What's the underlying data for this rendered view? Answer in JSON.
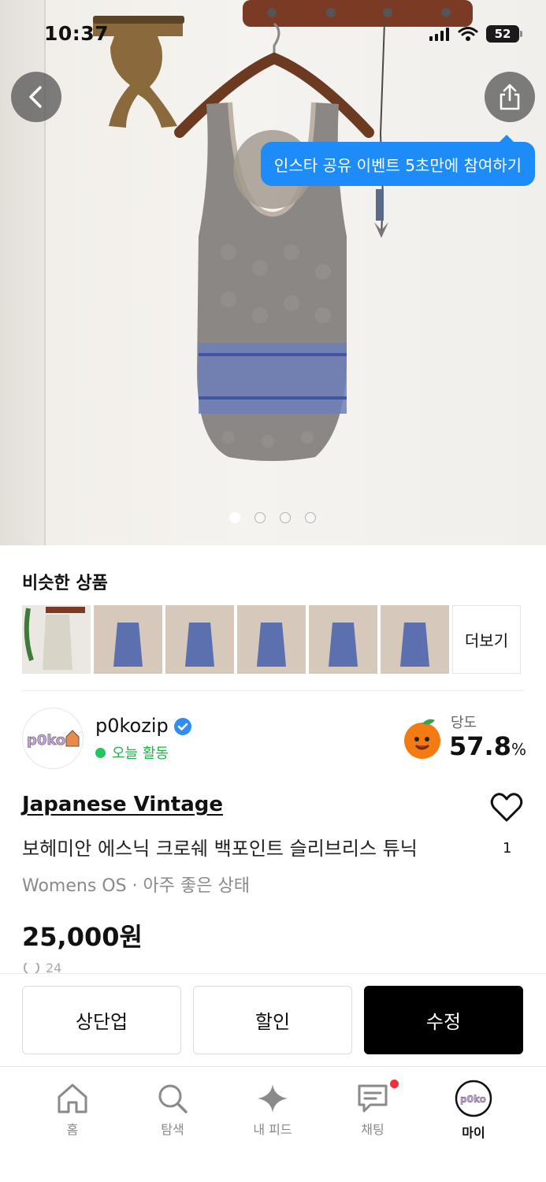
{
  "status_bar": {
    "time": "10:37",
    "battery": "52"
  },
  "hero": {
    "back_icon": "chevron-left-icon",
    "share_icon": "share-icon",
    "tooltip": "인스타 공유 이벤트 5초만에 참여하기",
    "page_count": 4,
    "active_page": 0
  },
  "similar": {
    "title": "비슷한 상품",
    "more_label": "더보기",
    "thumb_count": 6
  },
  "seller": {
    "name": "p0kozip",
    "activity": "오늘 활동",
    "dangdo_label": "당도",
    "dangdo_value": "57.8",
    "dangdo_unit": "%",
    "avatar_text": "p0ko"
  },
  "product": {
    "brand": "Japanese Vintage",
    "title": "보헤미안 에스닉 크로쉐 백포인트 슬리브리스 튜닉",
    "meta": "Womens OS · 아주 좋은 상태",
    "price": "25,000원",
    "views": "24",
    "likes": "1"
  },
  "actions": {
    "bump_label": "상단업",
    "discount_label": "할인",
    "edit_label": "수정"
  },
  "tabs": [
    {
      "label": "홈",
      "icon": "home-icon"
    },
    {
      "label": "탐색",
      "icon": "search-icon"
    },
    {
      "label": "내 피드",
      "icon": "sparkle-icon"
    },
    {
      "label": "채팅",
      "icon": "chat-icon"
    },
    {
      "label": "마이",
      "icon": "profile-avatar-icon"
    }
  ],
  "colors": {
    "accent_blue": "#1d8cf8",
    "activity_green": "#22c55e",
    "chat_badge": "#f0313c",
    "primary_button": "#000000"
  }
}
